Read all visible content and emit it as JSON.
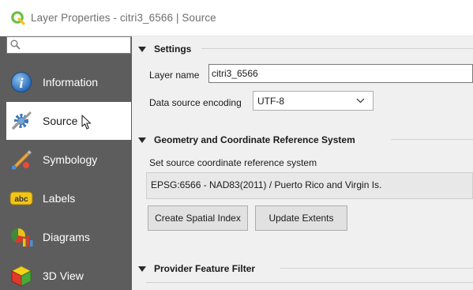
{
  "window": {
    "title": "Layer Properties - citri3_6566 | Source"
  },
  "sidebar": {
    "search_value": "",
    "items": [
      {
        "label": "Information",
        "icon": "information-icon",
        "selected": false
      },
      {
        "label": "Source",
        "icon": "source-icon",
        "selected": true
      },
      {
        "label": "Symbology",
        "icon": "symbology-icon",
        "selected": false
      },
      {
        "label": "Labels",
        "icon": "labels-icon",
        "selected": false
      },
      {
        "label": "Diagrams",
        "icon": "diagrams-icon",
        "selected": false
      },
      {
        "label": "3D View",
        "icon": "3d-view-icon",
        "selected": false
      }
    ],
    "labels_icon_text": "abc"
  },
  "settings": {
    "header": "Settings",
    "layer_name_label": "Layer name",
    "layer_name_value": "citri3_6566",
    "encoding_label": "Data source encoding",
    "encoding_value": "UTF-8"
  },
  "geometry": {
    "header": "Geometry and Coordinate Reference System",
    "crs_label": "Set source coordinate reference system",
    "crs_value": "EPSG:6566 - NAD83(2011) / Puerto Rico and Virgin Is.",
    "spatial_index_button": "Create Spatial Index",
    "update_extents_button": "Update Extents"
  },
  "filter": {
    "header": "Provider Feature Filter"
  },
  "colors": {
    "sidebar_bg": "#5d5d5d",
    "selected_bg": "#ffffff",
    "qgis_green": "#6abf45"
  }
}
